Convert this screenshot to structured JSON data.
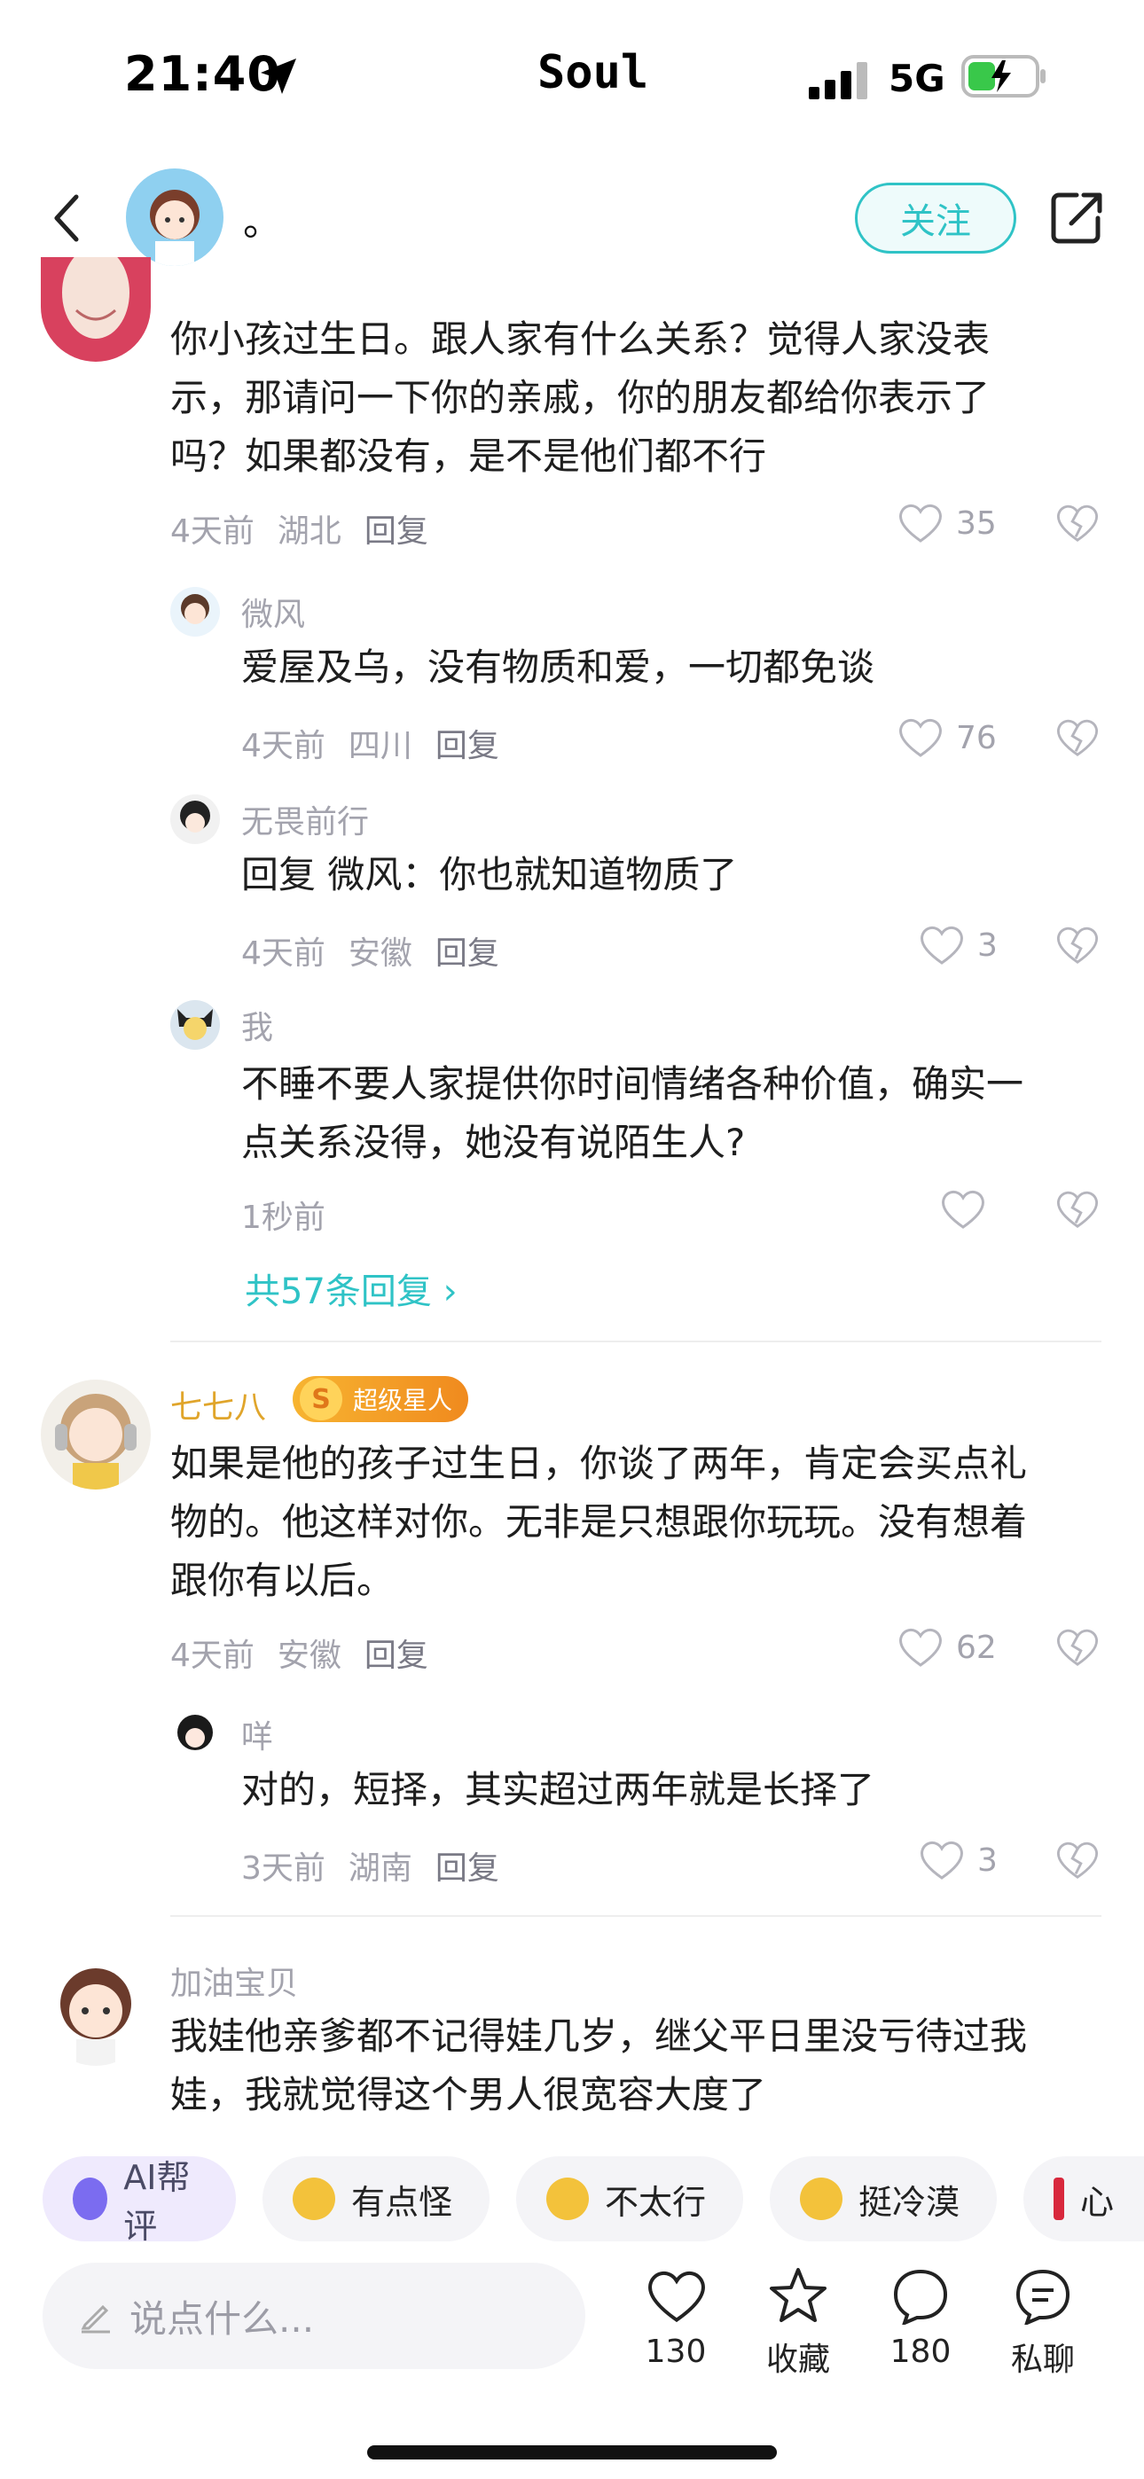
{
  "status_bar": {
    "time": "21:40",
    "app_name": "Soul",
    "network": "5G"
  },
  "header": {
    "name": "。",
    "follow_label": "关注"
  },
  "comments": [
    {
      "text_lines": [
        "你小孩过生日。跟人家有什么关系？觉得人家没表",
        "示，那请问一下你的亲戚，你的朋友都给你表示了",
        "吗？如果都没有，是不是他们都不行"
      ],
      "time": "4天前",
      "location": "湖北",
      "reply_label": "回复",
      "likes": "35",
      "replies": [
        {
          "name": "微风",
          "text_lines": [
            "爱屋及乌，没有物质和爱，一切都免谈"
          ],
          "time": "4天前",
          "location": "四川",
          "reply_label": "回复",
          "likes": "76"
        },
        {
          "name": "无畏前行",
          "text_lines": [
            "回复 微风：你也就知道物质了"
          ],
          "time": "4天前",
          "location": "安徽",
          "reply_label": "回复",
          "likes": "3"
        },
        {
          "name": "我",
          "text_lines": [
            "不睡不要人家提供你时间情绪各种价值，确实一",
            "点关系没得，她没有说陌生人?"
          ],
          "time": "1秒前",
          "likes": ""
        }
      ],
      "more_replies": "共57条回复"
    },
    {
      "name": "七七八",
      "badge": "超级星人",
      "text_lines": [
        "如果是他的孩子过生日，你谈了两年，肯定会买点礼",
        "物的。他这样对你。无非是只想跟你玩玩。没有想着",
        "跟你有以后。"
      ],
      "time": "4天前",
      "location": "安徽",
      "reply_label": "回复",
      "likes": "62",
      "replies": [
        {
          "name": "咩",
          "text_lines": [
            "对的，短择，其实超过两年就是长择了"
          ],
          "time": "3天前",
          "location": "湖南",
          "reply_label": "回复",
          "likes": "3"
        }
      ]
    },
    {
      "name": "加油宝贝",
      "text_lines": [
        "我娃他亲爹都不记得娃几岁，继父平日里没亏待过我",
        "娃，我就觉得这个男人很宽容大度了"
      ]
    }
  ],
  "chips": [
    "AI帮评",
    "有点怪",
    "不太行",
    "挺冷漠",
    "心"
  ],
  "bottom_bar": {
    "input_placeholder": "说点什么...",
    "like_count": "130",
    "collect_label": "收藏",
    "comment_count": "180",
    "chat_label": "私聊"
  },
  "colors": {
    "accent": "#2fc3c6",
    "gold": "#e0a52b",
    "muted": "#a3a3ad"
  }
}
